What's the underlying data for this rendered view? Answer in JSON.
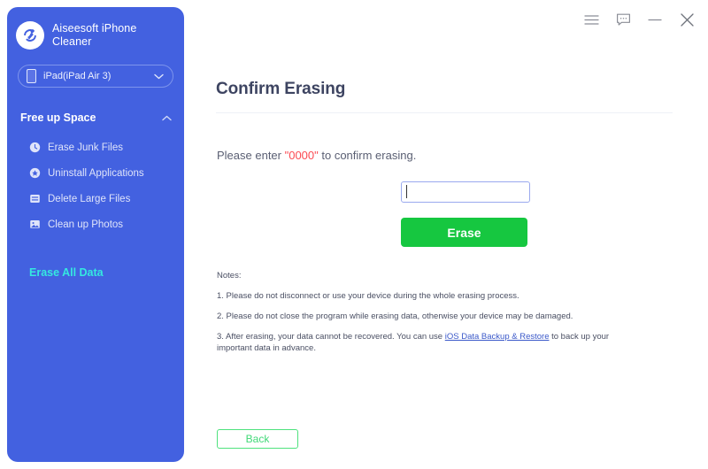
{
  "app": {
    "brand_name": "Aiseesoft iPhone Cleaner",
    "logo_icon": "brush-circle-icon"
  },
  "titlebar": {
    "buttons": [
      {
        "name": "menu-button",
        "icon": "hamburger-menu-icon"
      },
      {
        "name": "feedback-button",
        "icon": "chat-bubble-icon"
      },
      {
        "name": "minimize-button",
        "icon": "minimize-icon"
      },
      {
        "name": "close-button",
        "icon": "close-icon"
      }
    ]
  },
  "sidebar": {
    "device_selector": {
      "value": "iPad(iPad Air 3)",
      "icon": "phone-icon",
      "chevron": "chevron-down-icon"
    },
    "section": {
      "title": "Free up Space",
      "chevron": "chevron-up-icon",
      "expanded": true
    },
    "items": [
      {
        "label": "Erase Junk Files",
        "icon": "clock-icon"
      },
      {
        "label": "Uninstall Applications",
        "icon": "app-star-icon"
      },
      {
        "label": "Delete Large Files",
        "icon": "file-list-icon"
      },
      {
        "label": "Clean up Photos",
        "icon": "photo-icon"
      }
    ],
    "erase_all_data": {
      "label": "Erase All Data",
      "color": "#35e8e0",
      "active": true
    },
    "background_color": "#4361e0"
  },
  "main": {
    "title": "Confirm Erasing",
    "confirm_prompt": {
      "before": "Please enter ",
      "code": "\"0000\"",
      "after": " to confirm erasing.",
      "code_color": "#fb4b53"
    },
    "code_input": {
      "value": "",
      "placeholder": ""
    },
    "erase_button": {
      "label": "Erase",
      "color": "#16c740"
    },
    "back_button": {
      "label": "Back",
      "color": "#41d978"
    },
    "notes": {
      "heading": "Notes:",
      "lines": [
        "1. Please do not disconnect or use your device during the whole erasing process.",
        "2. Please do not close the program while erasing data, otherwise your device may be damaged."
      ],
      "line3": {
        "before": "3. After erasing, your data cannot be recovered. You can use ",
        "link": "iOS Data Backup & Restore",
        "after": " to back up your important data in advance."
      }
    }
  }
}
